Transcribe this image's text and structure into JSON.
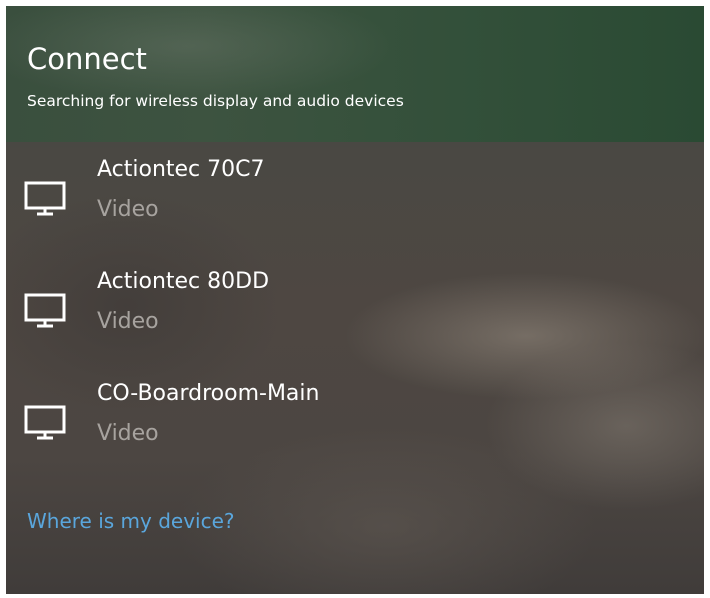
{
  "connect": {
    "title": "Connect",
    "subtitle": "Searching for wireless display and audio devices",
    "devices": [
      {
        "name": "Actiontec 70C7",
        "type": "Video",
        "icon": "monitor-icon"
      },
      {
        "name": "Actiontec 80DD",
        "type": "Video",
        "icon": "monitor-icon"
      },
      {
        "name": "CO-Boardroom-Main",
        "type": "Video",
        "icon": "monitor-icon"
      }
    ],
    "help_link": "Where is my device?"
  },
  "colors": {
    "accent_link": "#5aa6dc",
    "primary_text": "#ffffff",
    "secondary_text": "#a7a39f"
  }
}
